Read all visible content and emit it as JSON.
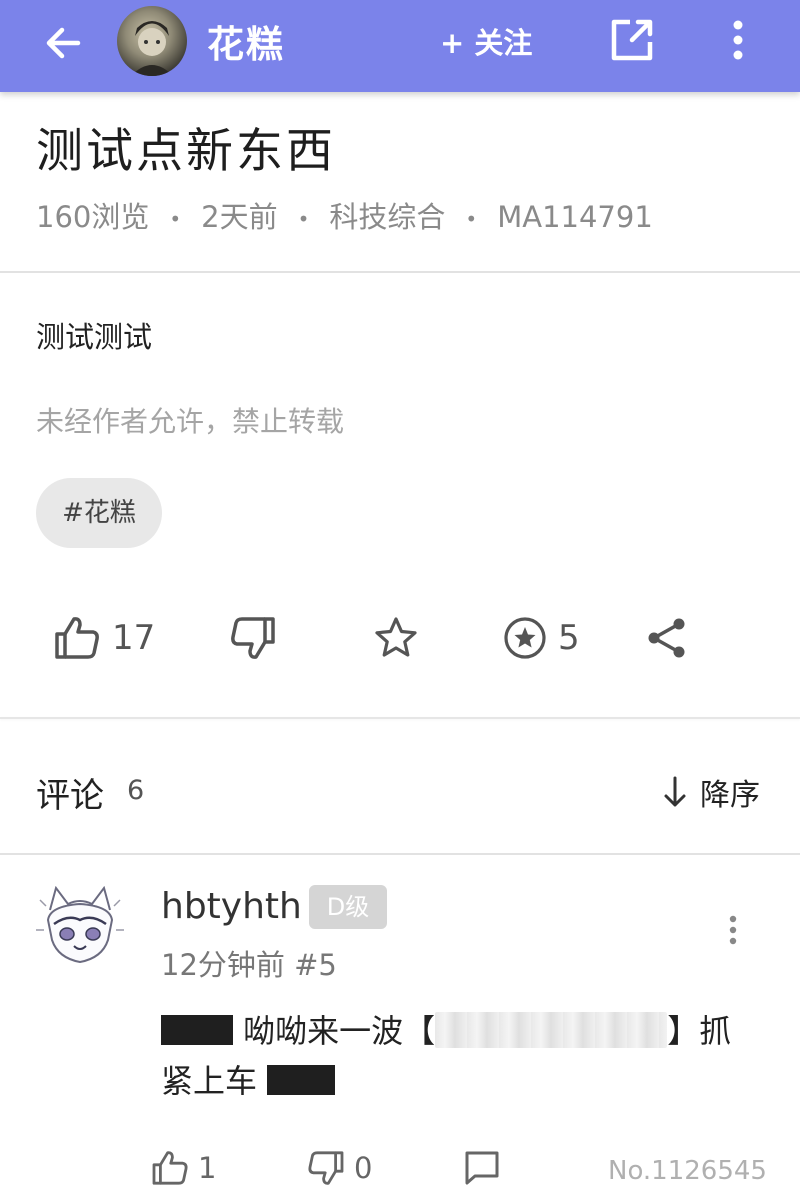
{
  "header": {
    "username": "花糕",
    "follow_label": "+ 关注",
    "colors": {
      "bar": "#7b83ea",
      "text": "#ffffff"
    }
  },
  "post": {
    "title": "测试点新东西",
    "views": "160浏览",
    "time": "2天前",
    "category": "科技综合",
    "id": "MA114791",
    "dot": "•",
    "body": "测试测试",
    "copyright": "未经作者允许，禁止转载",
    "tag": "#花糕"
  },
  "actions": {
    "like_count": "17",
    "coin_count": "5"
  },
  "comments": {
    "heading": "评论",
    "count": "6",
    "sort_label": "降序",
    "items": [
      {
        "user": "hbtyhth",
        "level": "D级",
        "meta": "12分钟前 #5",
        "text_a": " 呦呦来一波【",
        "text_b": "】抓紧上车 ",
        "likes": "1",
        "dislikes": "0",
        "number": "No.1126545"
      }
    ]
  }
}
